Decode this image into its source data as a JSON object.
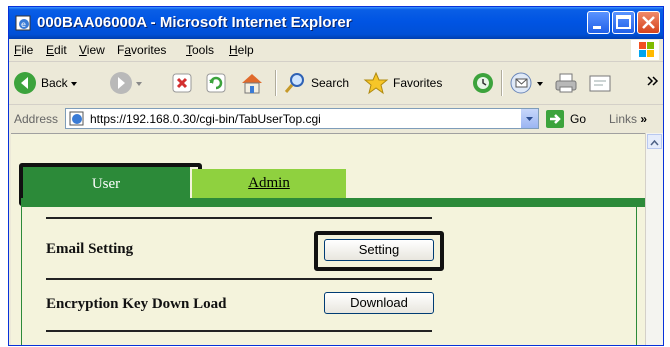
{
  "window": {
    "title": "000BAA06000A - Microsoft Internet Explorer"
  },
  "menu": [
    "File",
    "Edit",
    "View",
    "Favorites",
    "Tools",
    "Help"
  ],
  "menu_mnemonics": [
    "F",
    "E",
    "V",
    "a",
    "T",
    "H"
  ],
  "toolbar": {
    "back_label": "Back",
    "search_label": "Search",
    "favorites_label": "Favorites"
  },
  "address": {
    "label": "Address",
    "url": "https://192.168.0.30/cgi-bin/TabUserTop.cgi",
    "go_label": "Go",
    "links_label": "Links"
  },
  "tabs": [
    {
      "label": "User",
      "active": true
    },
    {
      "label": "Admin",
      "active": false
    }
  ],
  "settings": [
    {
      "label": "Email Setting",
      "button": "Setting"
    },
    {
      "label": "Encryption Key Down Load",
      "button": "Download"
    }
  ],
  "colors": {
    "active_tab": "#2c8a39",
    "inactive_tab": "#8fd13f",
    "content_bg": "#f4f3dc",
    "title_bar": "#0054e3"
  },
  "icons": [
    "ie-page-icon",
    "minimize-icon",
    "maximize-icon",
    "close-icon",
    "windows-logo-icon",
    "back-arrow-icon",
    "forward-arrow-icon",
    "stop-icon",
    "refresh-icon",
    "home-icon",
    "search-icon",
    "favorites-star-icon",
    "history-icon",
    "mail-icon",
    "print-icon",
    "edit-icon",
    "go-arrow-icon"
  ]
}
